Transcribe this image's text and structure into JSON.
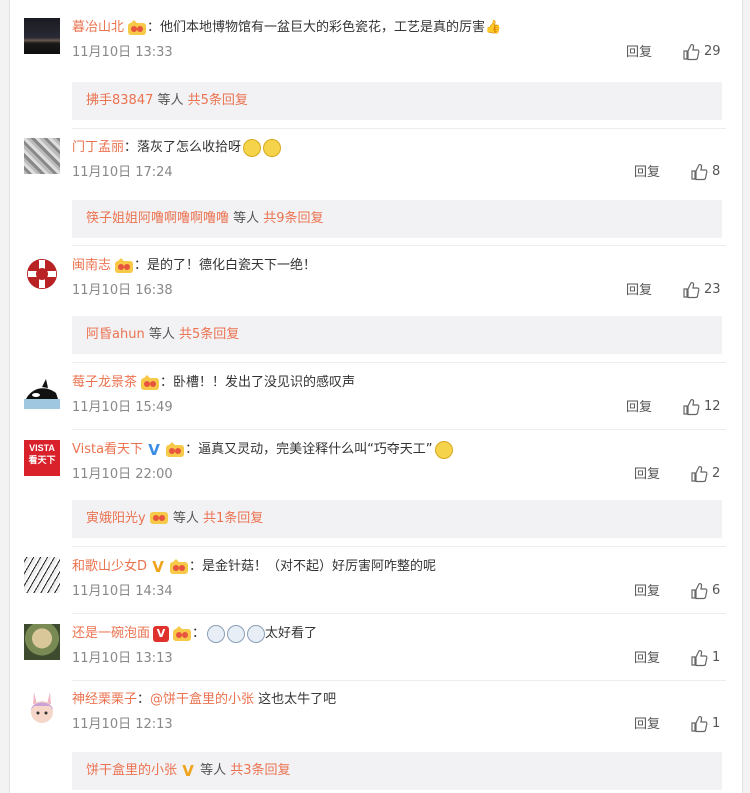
{
  "comments": [
    {
      "username": "暮冶山北",
      "text": "：他们本地博物馆有一盆巨大的彩色瓷花，工艺是真的厉害👍",
      "time": "11月10日 13:33",
      "reply_label": "回复",
      "likes": "29",
      "avatar_icon": "dark-landscape-avatar",
      "sub": {
        "user": "拂手83847",
        "mid": " 等人 ",
        "count": "共5条回复"
      }
    },
    {
      "username": "门丁孟丽",
      "text": "：落灰了怎么收拾呀",
      "time": "11月10日 17:24",
      "reply_label": "回复",
      "likes": "8",
      "avatar_icon": "gray-photo-avatar",
      "sub": {
        "user": "筷子姐姐阿噜啊噜啊噜噜",
        "mid": " 等人 ",
        "count": "共9条回复"
      }
    },
    {
      "username": "闽南志",
      "text": "：是的了！德化白瓷天下一绝！",
      "time": "11月10日 16:38",
      "reply_label": "回复",
      "likes": "23",
      "avatar_icon": "red-ornament-avatar",
      "sub": {
        "user": "阿昏ahun",
        "mid": " 等人 ",
        "count": "共5条回复"
      }
    },
    {
      "username": "莓子龙景茶",
      "text": "：卧槽！！发出了没见识的感叹声",
      "time": "11月10日 15:49",
      "reply_label": "回复",
      "likes": "12",
      "avatar_icon": "orca-avatar",
      "sub": null
    },
    {
      "username": "Vista看天下",
      "text": "：逼真又灵动，完美诠释什么叫“巧夺天工”",
      "time": "11月10日 22:00",
      "reply_label": "回复",
      "likes": "2",
      "avatar_icon": "vista-logo-avatar",
      "avatar_text_top": "VISTA",
      "avatar_text_bottom": "看天下",
      "sub": {
        "user": "寅娥阳光y",
        "mid": " 等人 ",
        "count": "共1条回复"
      }
    },
    {
      "username": "和歌山少女D",
      "text": "：是金针菇！（对不起）好厉害阿咋整的呢",
      "time": "11月10日 14:34",
      "reply_label": "回复",
      "likes": "6",
      "avatar_icon": "manga-avatar",
      "sub": null
    },
    {
      "username": "还是一碗泡面",
      "text": "太好看了",
      "time": "11月10日 13:13",
      "reply_label": "回复",
      "likes": "1",
      "avatar_icon": "cartoon-avatar",
      "sub": null
    },
    {
      "username": "神经栗栗子",
      "mention": "@饼干盒里的小张",
      "text": " 这也太牛了吧",
      "time": "11月10日 12:13",
      "reply_label": "回复",
      "likes": "1",
      "avatar_icon": "bunny-girl-avatar",
      "sub": {
        "user": "饼干盒里的小张",
        "mid": " 等人 ",
        "count": "共3条回复"
      }
    }
  ]
}
